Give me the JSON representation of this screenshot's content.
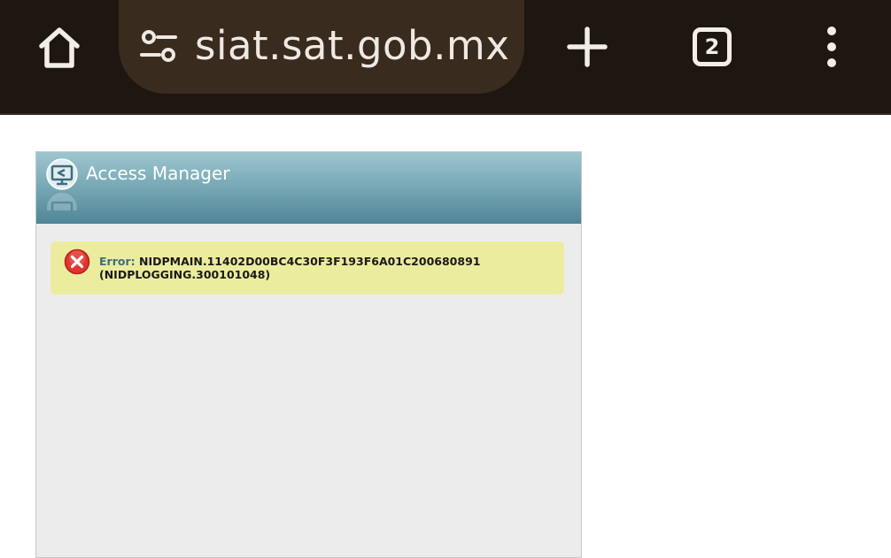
{
  "browser": {
    "url": "siat.sat.gob.mx",
    "tab_count": "2",
    "icons": {
      "home": "home-icon",
      "site_info": "tune-icon",
      "new_tab": "plus-icon",
      "tabs": "tab-switcher-icon",
      "menu": "more-vert-icon"
    },
    "colors": {
      "toolbar_bg": "#1e1611",
      "urlbar_bg": "#3a2b1f",
      "icon_fg": "#f1ede9"
    }
  },
  "panel": {
    "title": "Access Manager",
    "header_icon": "access-manager-icon",
    "error": {
      "label": "Error:",
      "code": "NIDPMAIN.11402D00BC4C30F3F193F6A01C200680891",
      "detail": "(NIDPLOGGING.300101048)",
      "icon": "error-x-icon",
      "bg_color": "#ecec9e"
    }
  }
}
